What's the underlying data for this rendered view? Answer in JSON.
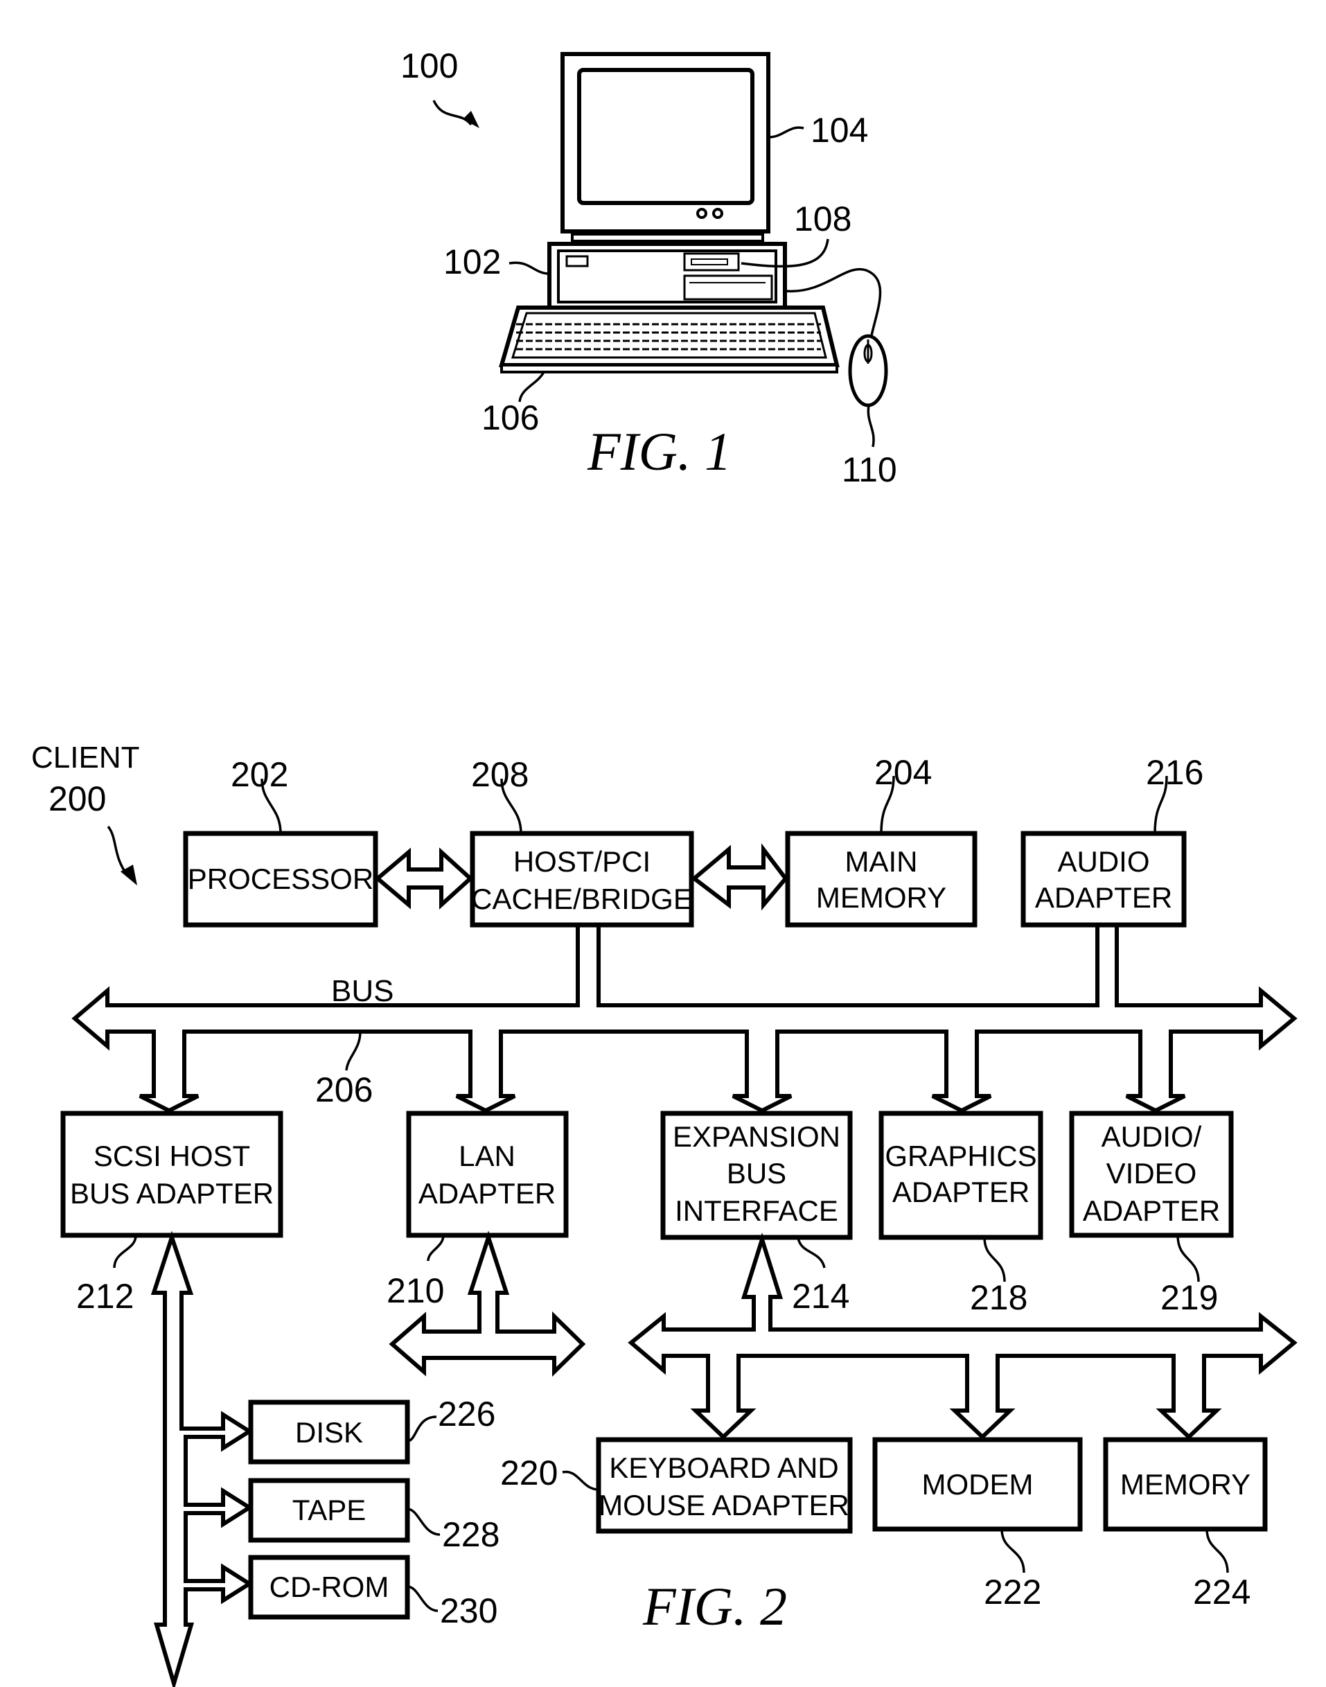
{
  "figure1": {
    "caption": "FIG. 1",
    "refs": {
      "system": "100",
      "system_unit": "102",
      "monitor": "104",
      "keyboard": "106",
      "storage": "108",
      "mouse": "110"
    }
  },
  "figure2": {
    "caption": "FIG. 2",
    "client_label": "CLIENT",
    "client_ref": "200",
    "bus_label": "BUS",
    "bus_ref": "206",
    "blocks": {
      "processor": {
        "ref": "202",
        "lines": [
          "PROCESSOR"
        ]
      },
      "host_pci": {
        "ref": "208",
        "lines": [
          "HOST/PCI",
          "CACHE/BRIDGE"
        ]
      },
      "main_memory": {
        "ref": "204",
        "lines": [
          "MAIN",
          "MEMORY"
        ]
      },
      "audio_adapter": {
        "ref": "216",
        "lines": [
          "AUDIO",
          "ADAPTER"
        ]
      },
      "scsi": {
        "ref": "212",
        "lines": [
          "SCSI HOST",
          "BUS ADAPTER"
        ]
      },
      "lan": {
        "ref": "210",
        "lines": [
          "LAN",
          "ADAPTER"
        ]
      },
      "expansion": {
        "ref": "214",
        "lines": [
          "EXPANSION",
          "BUS",
          "INTERFACE"
        ]
      },
      "graphics": {
        "ref": "218",
        "lines": [
          "GRAPHICS",
          "ADAPTER"
        ]
      },
      "av_adapter": {
        "ref": "219",
        "lines": [
          "AUDIO/",
          "VIDEO",
          "ADAPTER"
        ]
      },
      "disk": {
        "ref": "226",
        "lines": [
          "DISK"
        ]
      },
      "tape": {
        "ref": "228",
        "lines": [
          "TAPE"
        ]
      },
      "cdrom": {
        "ref": "230",
        "lines": [
          "CD-ROM"
        ]
      },
      "keyboard_mouse": {
        "ref": "220",
        "lines": [
          "KEYBOARD AND",
          "MOUSE ADAPTER"
        ]
      },
      "modem": {
        "ref": "222",
        "lines": [
          "MODEM"
        ]
      },
      "memory": {
        "ref": "224",
        "lines": [
          "MEMORY"
        ]
      }
    }
  }
}
